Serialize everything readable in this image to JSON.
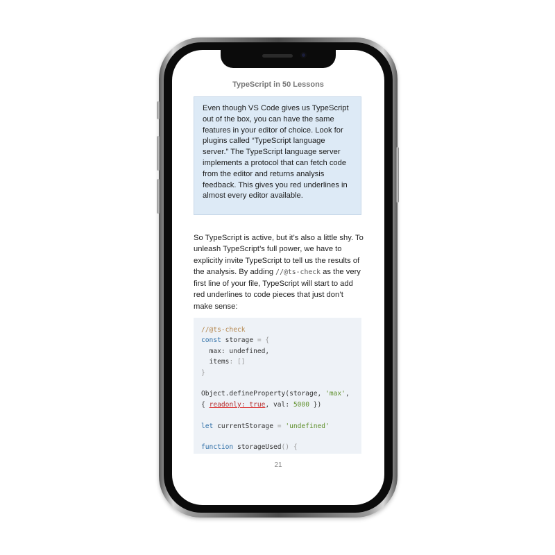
{
  "book": {
    "title": "TypeScript in 50 Lessons",
    "page_number": "21"
  },
  "note_box": {
    "text": "Even though VS Code gives us TypeScript out of the box, you can have the same features in your editor of choice. Look for plugins called “TypeScript language server.” The TypeScript language server implements a protocol that can fetch code from the editor and returns analysis feedback. This gives you red underlines in almost every editor available."
  },
  "body": {
    "text_before_code": "So TypeScript is active, but it’s also a little shy. To unleash TypeScript’s full power, we have to explicitly invite TypeScript to tell us the results of the analysis. By adding ",
    "inline_code": "//@ts-check",
    "text_after_code": " as the very first line of your file, TypeScript will start to add red underlines to code pieces that just don’t make sense:"
  },
  "code": {
    "l1_comment": "//@ts-check",
    "l2_kw": "const",
    "l2_name": " storage ",
    "l2_eq": "= {",
    "l3": "  max: undefined,",
    "l4_a": "  items",
    "l4_b": ": []",
    "l5": "}",
    "l7_a": "Object.defineProperty",
    "l7_b": "(storage, ",
    "l7_str": "'max'",
    "l7_c": ",",
    "l8_a": "{ ",
    "l8_err": "readonly: true",
    "l8_b": ", val: ",
    "l8_num": "5000",
    "l8_c": " })",
    "l10_kw": "let",
    "l10_name": " currentStorage ",
    "l10_eq": "= ",
    "l10_str": "'undefined'",
    "l12_kw": "function",
    "l12_name": " storageUsed",
    "l12_b": "() {"
  },
  "device": {
    "frame_color": "#0b0b0b",
    "note_bg": "#ddeaf6",
    "code_bg": "#eef2f7"
  }
}
